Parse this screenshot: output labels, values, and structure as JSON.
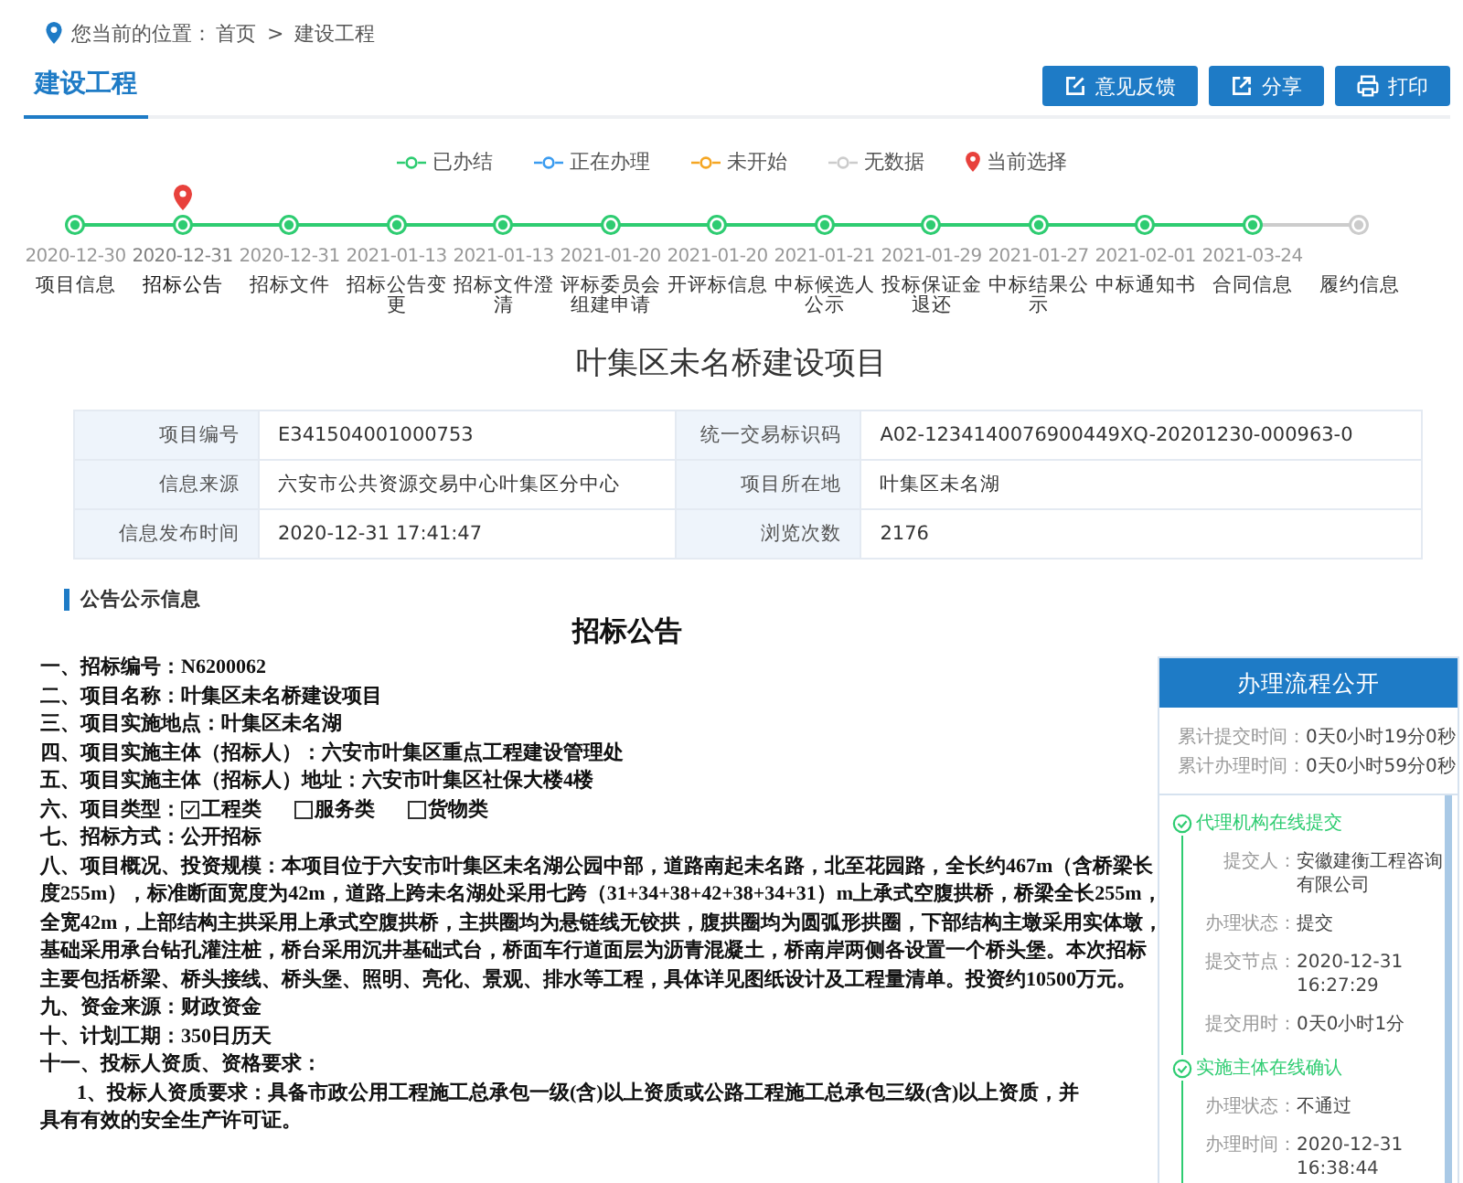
{
  "breadcrumb": {
    "prefix": "您当前的位置：",
    "items": [
      "首页",
      "建设工程"
    ],
    "separator": ">"
  },
  "tabs": [
    {
      "label": "建设工程",
      "selected": true
    }
  ],
  "buttons": [
    {
      "kind": "edit",
      "label": "意见反馈"
    },
    {
      "kind": "share",
      "label": "分享"
    },
    {
      "kind": "print",
      "label": "打印"
    }
  ],
  "legend": [
    {
      "label": "已办结",
      "kind": "status",
      "color": "#2ecc71"
    },
    {
      "label": "正在办理",
      "kind": "status",
      "color": "#3b9cf0"
    },
    {
      "label": "未开始",
      "kind": "status",
      "color": "#f5a623"
    },
    {
      "label": "无数据",
      "kind": "status",
      "color": "#cccccc"
    },
    {
      "label": "当前选择",
      "kind": "pin",
      "color": "#e8413c"
    }
  ],
  "timeline": [
    {
      "date": "2020-12-30",
      "label": "项目信息",
      "color": "#2ecc71",
      "selected": false
    },
    {
      "date": "2020-12-31",
      "label": "招标公告",
      "color": "#2ecc71",
      "selected": true
    },
    {
      "date": "2020-12-31",
      "label": "招标文件",
      "color": "#2ecc71",
      "selected": false
    },
    {
      "date": "2021-01-13",
      "label": "招标公告变更",
      "color": "#2ecc71",
      "selected": false
    },
    {
      "date": "2021-01-13",
      "label": "招标文件澄清",
      "color": "#2ecc71",
      "selected": false
    },
    {
      "date": "2021-01-20",
      "label": "评标委员会组建申请",
      "color": "#2ecc71",
      "selected": false
    },
    {
      "date": "2021-01-20",
      "label": "开评标信息",
      "color": "#2ecc71",
      "selected": false
    },
    {
      "date": "2021-01-21",
      "label": "中标候选人公示",
      "color": "#2ecc71",
      "selected": false
    },
    {
      "date": "2021-01-29",
      "label": "投标保证金退还",
      "color": "#2ecc71",
      "selected": false
    },
    {
      "date": "2021-01-27",
      "label": "中标结果公示",
      "color": "#2ecc71",
      "selected": false
    },
    {
      "date": "2021-02-01",
      "label": "中标通知书",
      "color": "#2ecc71",
      "selected": false
    },
    {
      "date": "2021-03-24",
      "label": "合同信息",
      "color": "#2ecc71",
      "selected": false
    },
    {
      "label": "履约信息",
      "color": "#cccccc",
      "selected": false
    }
  ],
  "project_title": "叶集区未名桥建设项目",
  "info_table": [
    [
      {
        "label": "项目编号",
        "value": "E341504001000753"
      },
      {
        "label": "统一交易标识码",
        "value": "A02-1234140076900449XQ-20201230-000963-0"
      }
    ],
    [
      {
        "label": "信息来源",
        "value": "六安市公共资源交易中心叶集区分中心"
      },
      {
        "label": "项目所在地",
        "value": "叶集区未名湖"
      }
    ],
    [
      {
        "label": "信息发布时间",
        "value": "2020-12-31 17:41:47"
      },
      {
        "label": "浏览次数",
        "value": "2176"
      }
    ]
  ],
  "section_title": "公告公示信息",
  "notice": {
    "title": "招标公告",
    "lines_before": [
      "一、招标编号：N6200062",
      "二、项目名称：叶集区未名桥建设项目",
      "三、项目实施地点：叶集区未名湖",
      "四、项目实施主体（招标人）：六安市叶集区重点工程建设管理处",
      "五、项目实施主体（招标人）地址：六安市叶集区社保大楼4楼"
    ],
    "type_label": "六、项目类型：",
    "project_types": [
      {
        "label": "工程类",
        "checked": true
      },
      {
        "label": "服务类",
        "checked": false
      },
      {
        "label": "货物类",
        "checked": false
      }
    ],
    "lines_after": [
      {
        "text": "七、招标方式：公开招标",
        "indent": false
      },
      {
        "text": "八、项目概况、投资规模：本项目位于六安市叶集区未名湖公园中部，道路南起未名路，北至花园路，全长约467m（含桥梁长",
        "indent": false
      },
      {
        "text": "度255m），标准断面宽度为42m，道路上跨未名湖处采用七跨（31+34+38+42+38+34+31）m上承式空腹拱桥，桥梁全长255m，",
        "indent": false
      },
      {
        "text": "全宽42m，上部结构主拱采用上承式空腹拱桥，主拱圈均为悬链线无铰拱，腹拱圈均为圆弧形拱圈，下部结构主墩采用实体墩，",
        "indent": false
      },
      {
        "text": "基础采用承台钻孔灌注桩，桥台采用沉井基础式台，桥面车行道面层为沥青混凝土，桥南岸两侧各设置一个桥头堡。本次招标",
        "indent": false
      },
      {
        "text": "主要包括桥梁、桥头接线、桥头堡、照明、亮化、景观、排水等工程，具体详见图纸设计及工程量清单。投资约10500万元。",
        "indent": false
      },
      {
        "text": "九、资金来源：财政资金",
        "indent": false
      },
      {
        "text": "十、计划工期：350日历天",
        "indent": false
      },
      {
        "text": "十一、投标人资质、资格要求：",
        "indent": false
      },
      {
        "text": "1、投标人资质要求：具备市政公用工程施工总承包一级(含)以上资质或公路工程施工总承包三级(含)以上资质，并",
        "indent": true
      },
      {
        "text": "具有有效的安全生产许可证。",
        "indent": false
      }
    ]
  },
  "process_panel": {
    "title": "办理流程公开",
    "summary": [
      {
        "label": "累计提交时间：",
        "value": "0天0小时19分0秒"
      },
      {
        "label": "累计办理时间：",
        "value": "0天0小时59分0秒"
      }
    ],
    "steps": [
      {
        "title": "代理机构在线提交",
        "fields": [
          {
            "label": "提交人：",
            "value": "安徽建衡工程咨询有限公司"
          },
          {
            "label": "办理状态：",
            "value": "提交"
          },
          {
            "label": "提交节点：",
            "value": "2020-12-31 16:27:29"
          },
          {
            "label": "提交用时：",
            "value": "0天0小时1分"
          }
        ]
      },
      {
        "title": "实施主体在线确认",
        "fields": [
          {
            "label": "办理状态：",
            "value": "不通过"
          },
          {
            "label": "办理时间：",
            "value": "2020-12-31 16:38:44"
          }
        ]
      }
    ]
  }
}
